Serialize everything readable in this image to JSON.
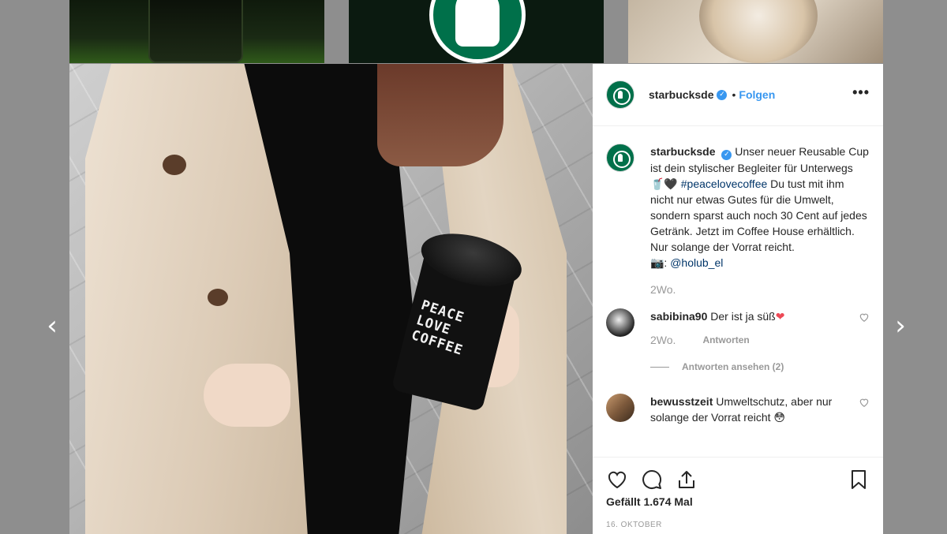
{
  "post": {
    "account": {
      "username": "starbucksde",
      "separator": "•",
      "follow_label": "Folgen",
      "more_label": "•••"
    },
    "caption": {
      "username": "starbucksde",
      "text_1": "Unser neuer Reusable Cup ist dein stylischer Begleiter für Unterwegs ",
      "emoji": "🥤🖤",
      "hashtag": "#peacelovecoffee",
      "text_2": "Du tust mit ihm nicht nur etwas Gutes für die Umwelt, sondern sparst auch noch 30 Cent auf jedes Getränk. Jetzt im Coffee House erhältlich. Nur solange der Vorrat reicht.",
      "camera": "📷:",
      "mention": "@holub_el",
      "time": "2Wo."
    },
    "comments": [
      {
        "username": "sabibina90",
        "text": "Der ist ja süß",
        "emoji": "❤",
        "time": "2Wo.",
        "reply_label": "Antworten",
        "view_replies": "Antworten ansehen (2)"
      },
      {
        "username": "bewusstzeit",
        "text": "Umweltschutz, aber nur solange der Vorrat reicht",
        "emoji": "😳"
      }
    ],
    "likes": "Gefällt 1.674 Mal",
    "date": "16. OKTOBER",
    "photo_cup_text": [
      "PEACE",
      "LOVE",
      "COFFEE"
    ]
  },
  "nav": {
    "prev": "‹",
    "next": "›"
  },
  "icons": {
    "verified": "verified-badge-icon",
    "heart": "heart-icon",
    "comment": "comment-icon",
    "share": "share-icon",
    "bookmark": "bookmark-icon"
  },
  "colors": {
    "link": "#3897f0",
    "hashtag": "#003569",
    "starbucks_green": "#00704a",
    "secondary_text": "#999999",
    "backdrop": "#8e8e8e"
  }
}
